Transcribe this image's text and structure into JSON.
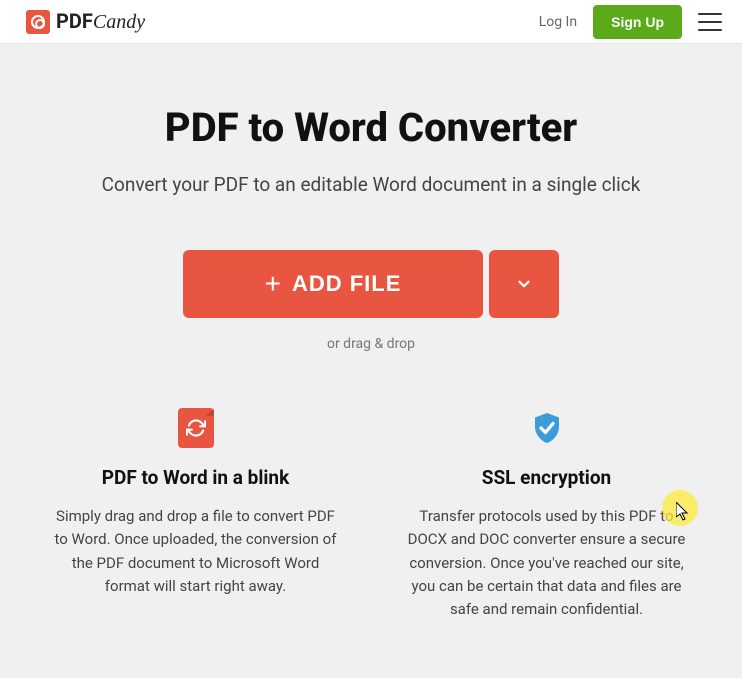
{
  "header": {
    "brand_pdf": "PDF",
    "brand_candy": "Candy",
    "login": "Log In",
    "signup": "Sign Up"
  },
  "hero": {
    "title": "PDF to Word Converter",
    "subtitle": "Convert your PDF to an editable Word document in a single click",
    "add_file_label": "ADD FILE",
    "drag_text": "or drag & drop"
  },
  "features": [
    {
      "title": "PDF to Word in a blink",
      "desc": "Simply drag and drop a file to convert PDF to Word. Once uploaded, the conversion of the PDF document to Microsoft Word format will start right away."
    },
    {
      "title": "SSL encryption",
      "desc": "Transfer protocols used by this PDF to DOCX and DOC converter ensure a secure conversion. Once you've reached our site, you can be certain that data and files are safe and remain confidential."
    }
  ]
}
